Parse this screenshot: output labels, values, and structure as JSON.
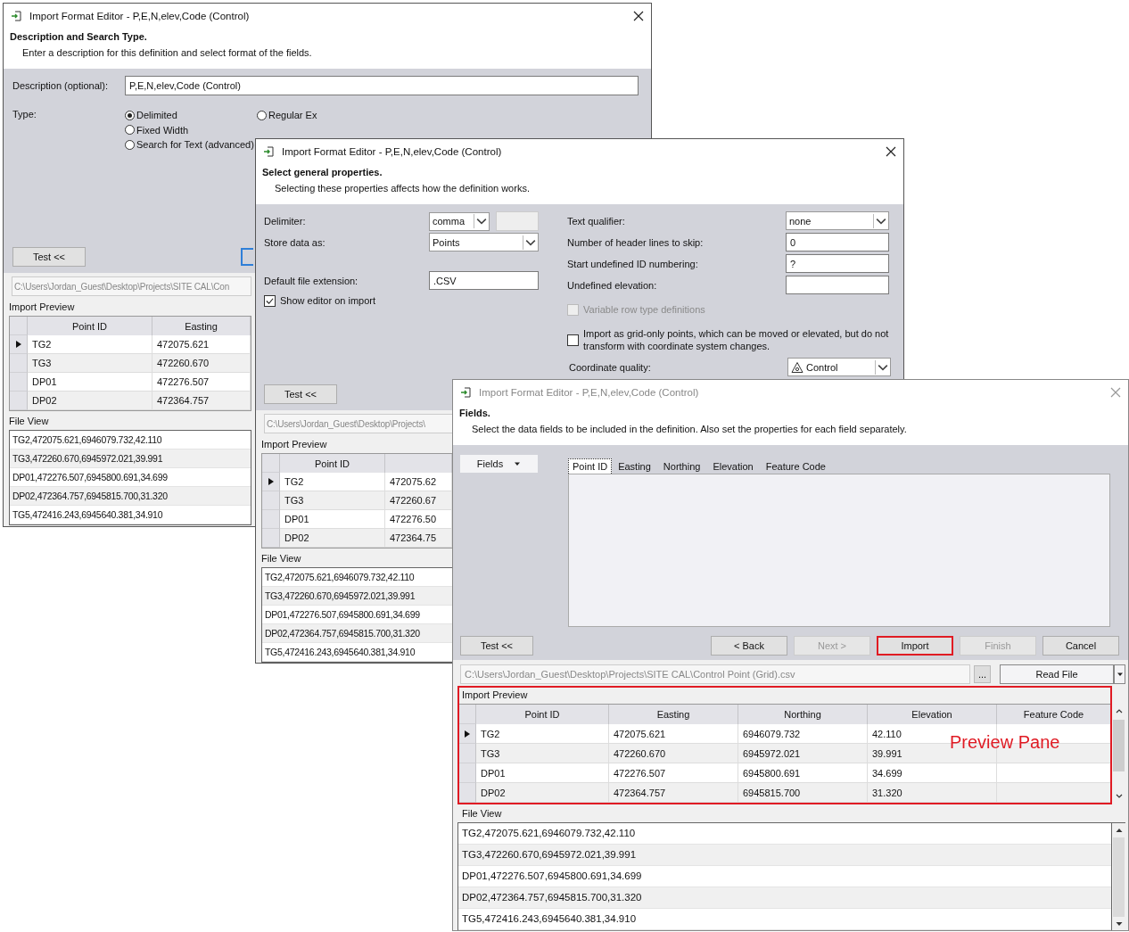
{
  "description_window": {
    "title": "Import Format Editor - P,E,N,elev,Code (Control)",
    "active": true,
    "heading": "Description and Search Type.",
    "subtitle": "Enter a description for this definition and select format of the fields.",
    "description": {
      "label": "Description (optional):",
      "value": "P,E,N,elev,Code (Control)"
    },
    "type": {
      "label": "Type:",
      "options": [
        {
          "label": "Delimited",
          "selected": true
        },
        {
          "label": "Fixed Width",
          "selected": false
        },
        {
          "label": "Search for Text (advanced)",
          "selected": false
        },
        {
          "label": "Regular Ex",
          "selected": false
        }
      ]
    },
    "test_button": "Test <<",
    "path": "C:\\Users\\Jordan_Guest\\Desktop\\Projects\\SITE CAL\\Con",
    "import_preview": {
      "label": "Import Preview",
      "columns": [
        "Point ID",
        "Easting"
      ],
      "rows": [
        {
          "selected": true,
          "cells": [
            "TG2",
            "472075.621"
          ]
        },
        {
          "selected": false,
          "cells": [
            "TG3",
            "472260.670"
          ]
        },
        {
          "selected": false,
          "cells": [
            "DP01",
            "472276.507"
          ]
        },
        {
          "selected": false,
          "cells": [
            "DP02",
            "472364.757"
          ]
        }
      ]
    },
    "file_view": {
      "label": "File View",
      "lines": [
        "TG2,472075.621,6946079.732,42.110",
        "TG3,472260.670,6945972.021,39.991",
        "DP01,472276.507,6945800.691,34.699",
        "DP02,472364.757,6945815.700,31.320",
        "TG5,472416.243,6945640.381,34.910"
      ]
    }
  },
  "properties_window": {
    "title": "Import Format Editor - P,E,N,elev,Code (Control)",
    "active": true,
    "heading": "Select general properties.",
    "subtitle": "Selecting these properties affects how the definition works.",
    "left": [
      {
        "kind": "dropdown_field",
        "label": "Delimiter:",
        "value": "comma"
      },
      {
        "kind": "dropdown",
        "label": "Store data as:",
        "value": "Points"
      },
      {
        "kind": "field",
        "label": "Default file extension:",
        "value": ".CSV"
      },
      {
        "kind": "checkbox",
        "label": "Show editor on import",
        "checked": true,
        "disabled": false
      }
    ],
    "right": [
      {
        "kind": "dropdown",
        "label": "Text qualifier:",
        "value": "none"
      },
      {
        "kind": "field",
        "label": "Number of header lines to skip:",
        "value": "0"
      },
      {
        "kind": "field",
        "label": "Start undefined ID numbering:",
        "value": "?"
      },
      {
        "kind": "field",
        "label": "Undefined elevation:"
      },
      {
        "kind": "checkbox",
        "label": "Variable row type definitions",
        "checked": false,
        "disabled": true
      },
      {
        "kind": "checkbox",
        "label": "Import as grid-only points, which can be moved or elevated, but do not transform with coordinate system changes.",
        "checked": false,
        "disabled": false
      },
      {
        "kind": "quality_dropdown",
        "label": "Coordinate quality:",
        "value": "Control"
      }
    ],
    "test_button": "Test <<",
    "path": "C:\\Users\\Jordan_Guest\\Desktop\\Projects\\",
    "import_preview": {
      "label": "Import Preview",
      "columns": [
        "Point ID"
      ],
      "rows": [
        {
          "selected": true,
          "cells": [
            "TG2",
            "472075.62"
          ]
        },
        {
          "selected": false,
          "cells": [
            "TG3",
            "472260.67"
          ]
        },
        {
          "selected": false,
          "cells": [
            "DP01",
            "472276.50"
          ]
        },
        {
          "selected": false,
          "cells": [
            "DP02",
            "472364.75"
          ]
        }
      ]
    },
    "file_view": {
      "label": "File View",
      "lines": [
        "TG2,472075.621,6946079.732,42.110",
        "TG3,472260.670,6945972.021,39.991",
        "DP01,472276.507,6945800.691,34.699",
        "DP02,472364.757,6945815.700,31.320",
        "TG5,472416.243,6945640.381,34.910"
      ]
    }
  },
  "fields_window": {
    "title": "Import Format Editor - P,E,N,elev,Code (Control)",
    "active": false,
    "heading": "Fields.",
    "subtitle": "Select the data fields to be included in the definition. Also set the properties for each field separately.",
    "fields_button": "Fields",
    "tabs": [
      {
        "label": "Point ID",
        "selected": true
      },
      {
        "label": "Easting",
        "selected": false
      },
      {
        "label": "Northing",
        "selected": false
      },
      {
        "label": "Elevation",
        "selected": false
      },
      {
        "label": "Feature Code",
        "selected": false
      }
    ],
    "test_button": "Test <<",
    "buttons": [
      {
        "label": "< Back",
        "disabled": false,
        "highlighted": false
      },
      {
        "label": "Next >",
        "disabled": true,
        "highlighted": false
      },
      {
        "label": "Import",
        "disabled": false,
        "highlighted": true
      },
      {
        "label": "Finish",
        "disabled": true,
        "highlighted": false
      },
      {
        "label": "Cancel",
        "disabled": false,
        "highlighted": false
      }
    ],
    "path": "C:\\Users\\Jordan_Guest\\Desktop\\Projects\\SITE CAL\\Control Point (Grid).csv",
    "browse_button": "...",
    "read_button": "Read File",
    "import_preview": {
      "label": "Import Preview",
      "columns": [
        "Point ID",
        "Easting",
        "Northing",
        "Elevation",
        "Feature Code"
      ],
      "rows": [
        {
          "selected": true,
          "cells": [
            "TG2",
            "472075.621",
            "6946079.732",
            "42.110"
          ]
        },
        {
          "selected": false,
          "cells": [
            "TG3",
            "472260.670",
            "6945972.021",
            "39.991"
          ]
        },
        {
          "selected": false,
          "cells": [
            "DP01",
            "472276.507",
            "6945800.691",
            "34.699"
          ]
        },
        {
          "selected": false,
          "cells": [
            "DP02",
            "472364.757",
            "6945815.700",
            "31.320"
          ]
        }
      ]
    },
    "annotation": {
      "label": "Preview Pane"
    },
    "file_view": {
      "label": "File View",
      "lines": [
        "TG2,472075.621,6946079.732,42.110",
        "TG3,472260.670,6945972.021,39.991",
        "DP01,472276.507,6945800.691,34.699",
        "DP02,472364.757,6945815.700,31.320",
        "TG5,472416.243,6945640.381,34.910"
      ]
    }
  }
}
